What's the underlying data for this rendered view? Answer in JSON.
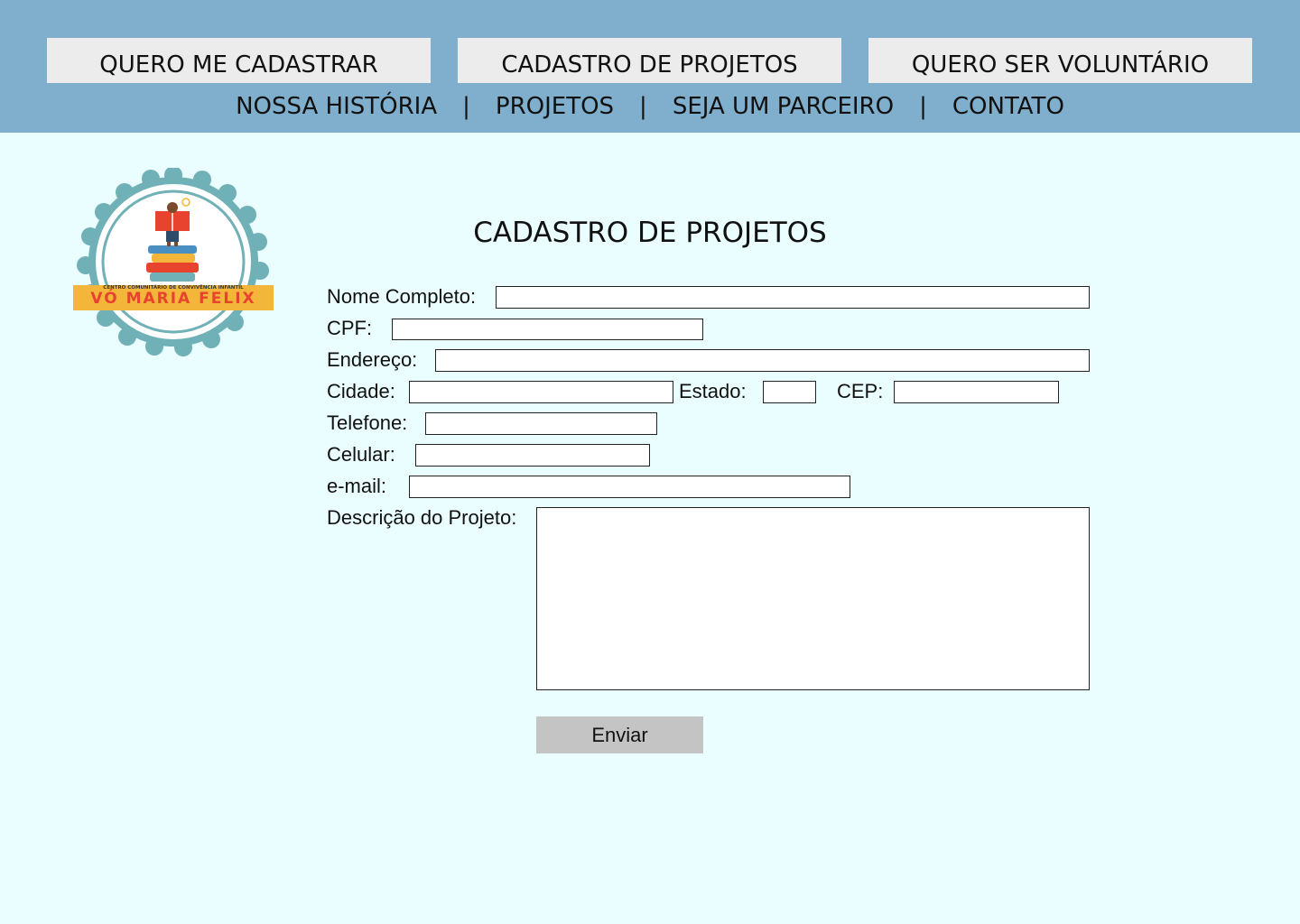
{
  "header": {
    "buttons": [
      {
        "label": "QUERO ME CADASTRAR"
      },
      {
        "label": "CADASTRO DE PROJETOS"
      },
      {
        "label": "QUERO SER VOLUNTÁRIO"
      }
    ],
    "nav": [
      {
        "label": "NOSSA HISTÓRIA"
      },
      {
        "label": "PROJETOS"
      },
      {
        "label": "SEJA UM PARCEIRO"
      },
      {
        "label": "CONTATO"
      }
    ],
    "separator": "|"
  },
  "logo": {
    "subtitle": "CENTRO COMUNITÁRIO DE CONVIVÊNCIA INFANTIL",
    "name": "VÓ MARIA FELIX"
  },
  "form": {
    "title": "CADASTRO DE PROJETOS",
    "labels": {
      "nome": "Nome Completo:",
      "cpf": "CPF:",
      "endereco": "Endereço:",
      "cidade": "Cidade:",
      "estado": "Estado:",
      "cep": "CEP:",
      "telefone": "Telefone:",
      "celular": "Celular:",
      "email": "e-mail:",
      "descricao": "Descrição do Projeto:"
    },
    "values": {
      "nome": "",
      "cpf": "",
      "endereco": "",
      "cidade": "",
      "estado": "",
      "cep": "",
      "telefone": "",
      "celular": "",
      "email": "",
      "descricao": ""
    },
    "submit_label": "Enviar"
  },
  "colors": {
    "header_bg": "#7fafcd",
    "page_bg": "#eafeff",
    "button_bg": "#ececec",
    "submit_bg": "#c4c4c4",
    "logo_ring": "#6fb1b6",
    "logo_banner": "#f4b63a",
    "logo_text": "#e8432f"
  }
}
